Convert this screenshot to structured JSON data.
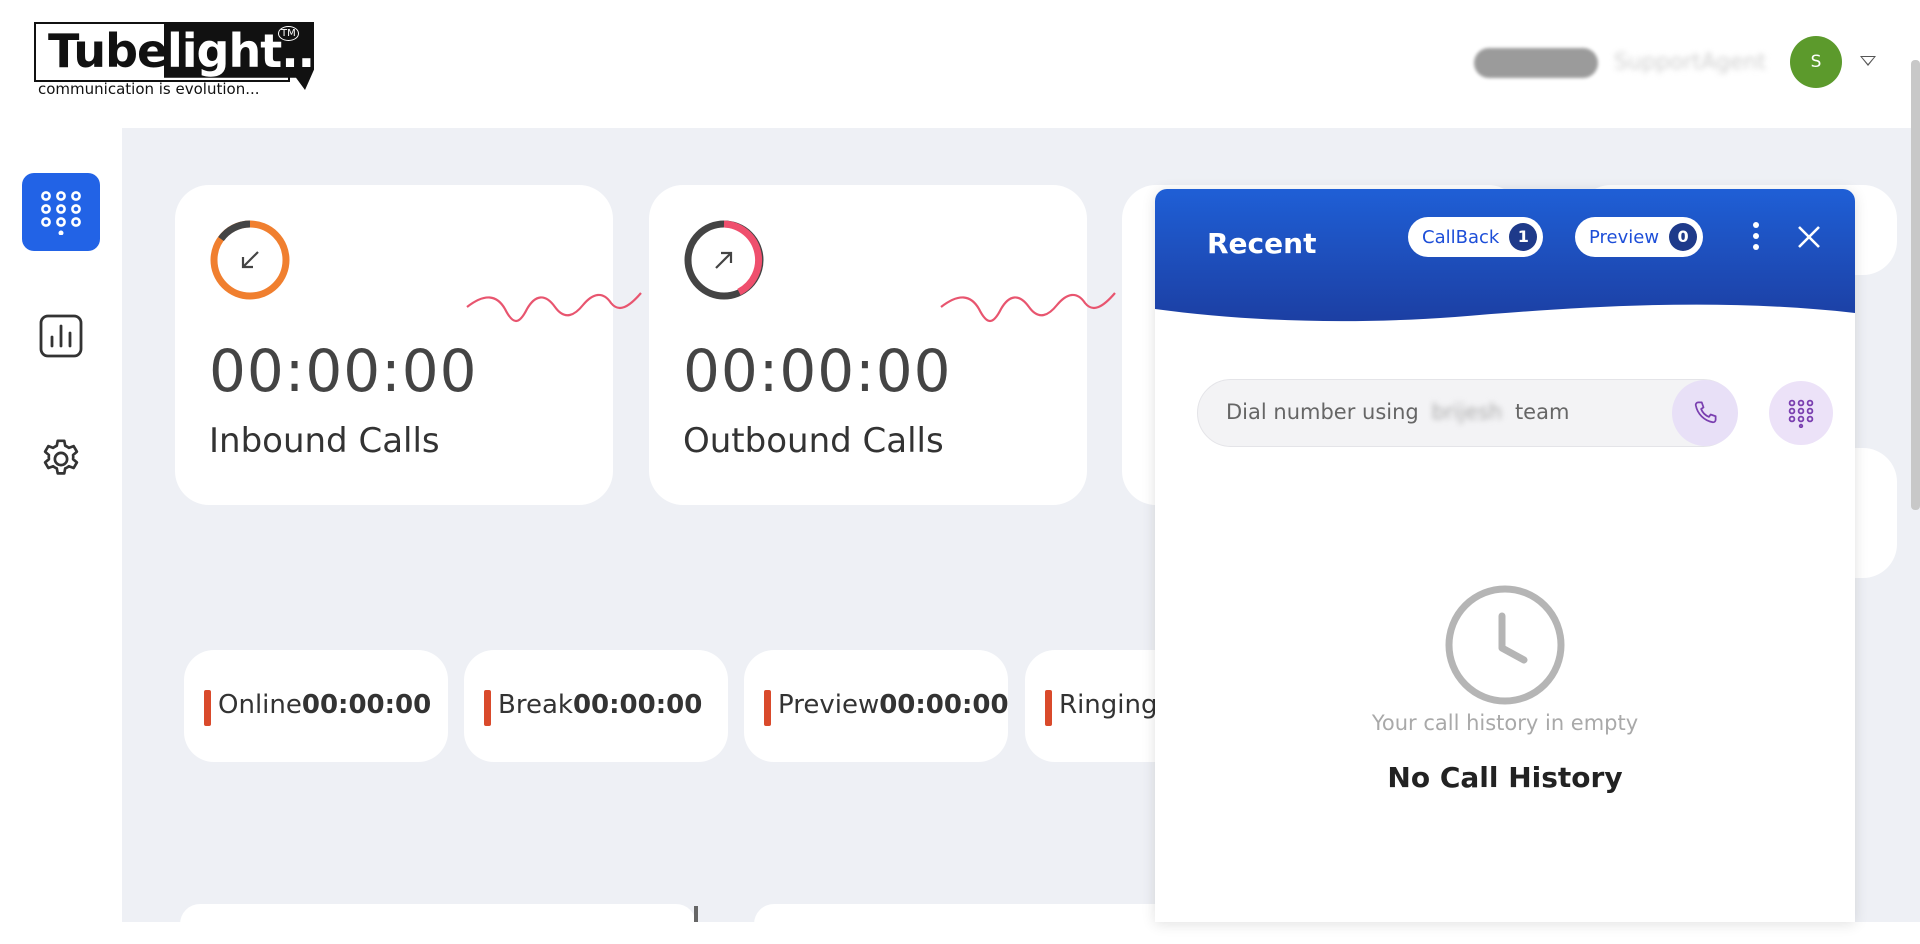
{
  "brand": {
    "logo_part1": "Tube",
    "logo_part2": "light...",
    "logo_tm": "TM",
    "tagline": "communication is evolution..."
  },
  "header": {
    "user_status_blurred": "Tubelight",
    "user_role_blurred": "SupportAgent",
    "avatar_initial": "S"
  },
  "sidebar": {
    "items": [
      {
        "icon": "dialpad-icon",
        "active": true
      },
      {
        "icon": "bar-chart-icon",
        "active": false
      },
      {
        "icon": "gear-icon",
        "active": false
      }
    ]
  },
  "stats": {
    "inbound": {
      "time": "00:00:00",
      "label": "Inbound Calls",
      "ring_color": "#f07f2f",
      "wave_color": "#e8556f"
    },
    "outbound": {
      "time": "00:00:00",
      "label": "Outbound Calls",
      "ring_color": "#ef4f6d",
      "wave_color": "#e8556f"
    }
  },
  "status_pills": [
    {
      "label": "Online",
      "time": "00:00:00"
    },
    {
      "label": "Break",
      "time": "00:00:00"
    },
    {
      "label": "Preview",
      "time": "00:00:00"
    },
    {
      "label": "Ringing",
      "time": ""
    }
  ],
  "recent_panel": {
    "title": "Recent",
    "callback_label": "CallBack",
    "callback_count": "1",
    "preview_label": "Preview",
    "preview_count": "0",
    "dial_placeholder_prefix": "Dial number using",
    "dial_placeholder_blurred": "brijesh",
    "dial_placeholder_suffix": "team",
    "empty_subtitle": "Your call history in empty",
    "empty_title": "No Call History"
  },
  "colors": {
    "accent_blue": "#2263e6",
    "panel_header_top": "#1f5fd6",
    "panel_header_bottom": "#1c3fa3",
    "status_bar": "#d94a2b"
  }
}
